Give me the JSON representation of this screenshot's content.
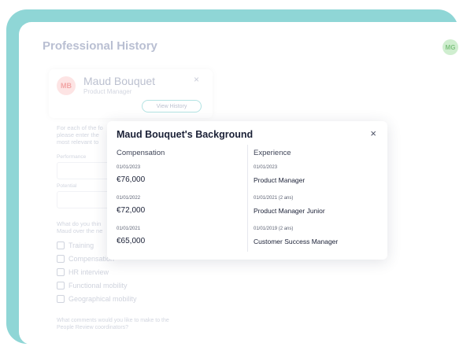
{
  "background": {
    "title": "Professional History",
    "user_avatar": "MG",
    "person": {
      "initials": "MB",
      "name": "Maud Bouquet",
      "role": "Product Manager",
      "close": "×"
    },
    "view_history": "View History",
    "intro_lines": [
      "For each of the fo",
      "please enter the",
      "most relevant to"
    ],
    "performance_label": "Performance",
    "potential_label": "Potential",
    "question_lines": [
      "What do you thin",
      "Maud over the ne"
    ],
    "options": [
      "Training",
      "Compensation",
      "HR interview",
      "Functional mobility",
      "Geographical mobility"
    ],
    "comment_lines": [
      "What comments would you like to make to the",
      "People Review coordinators?"
    ]
  },
  "modal": {
    "title": "Maud Bouquet's Background",
    "close": "×",
    "compensation": {
      "header": "Compensation",
      "entries": [
        {
          "date": "01/01/2023",
          "value": "€76,000"
        },
        {
          "date": "01/01/2022",
          "value": "€72,000"
        },
        {
          "date": "01/01/2021",
          "value": "€65,000"
        }
      ]
    },
    "experience": {
      "header": "Experience",
      "entries": [
        {
          "date": "01/01/2023",
          "value": "Product Manager"
        },
        {
          "date": "01/01/2021 (2 ans)",
          "value": "Product Manager Junior"
        },
        {
          "date": "01/01/2019 (2 ans)",
          "value": "Customer Success Manager"
        }
      ]
    }
  },
  "colors": {
    "teal": "#8fd6d6",
    "text_dark": "#1a2036"
  }
}
